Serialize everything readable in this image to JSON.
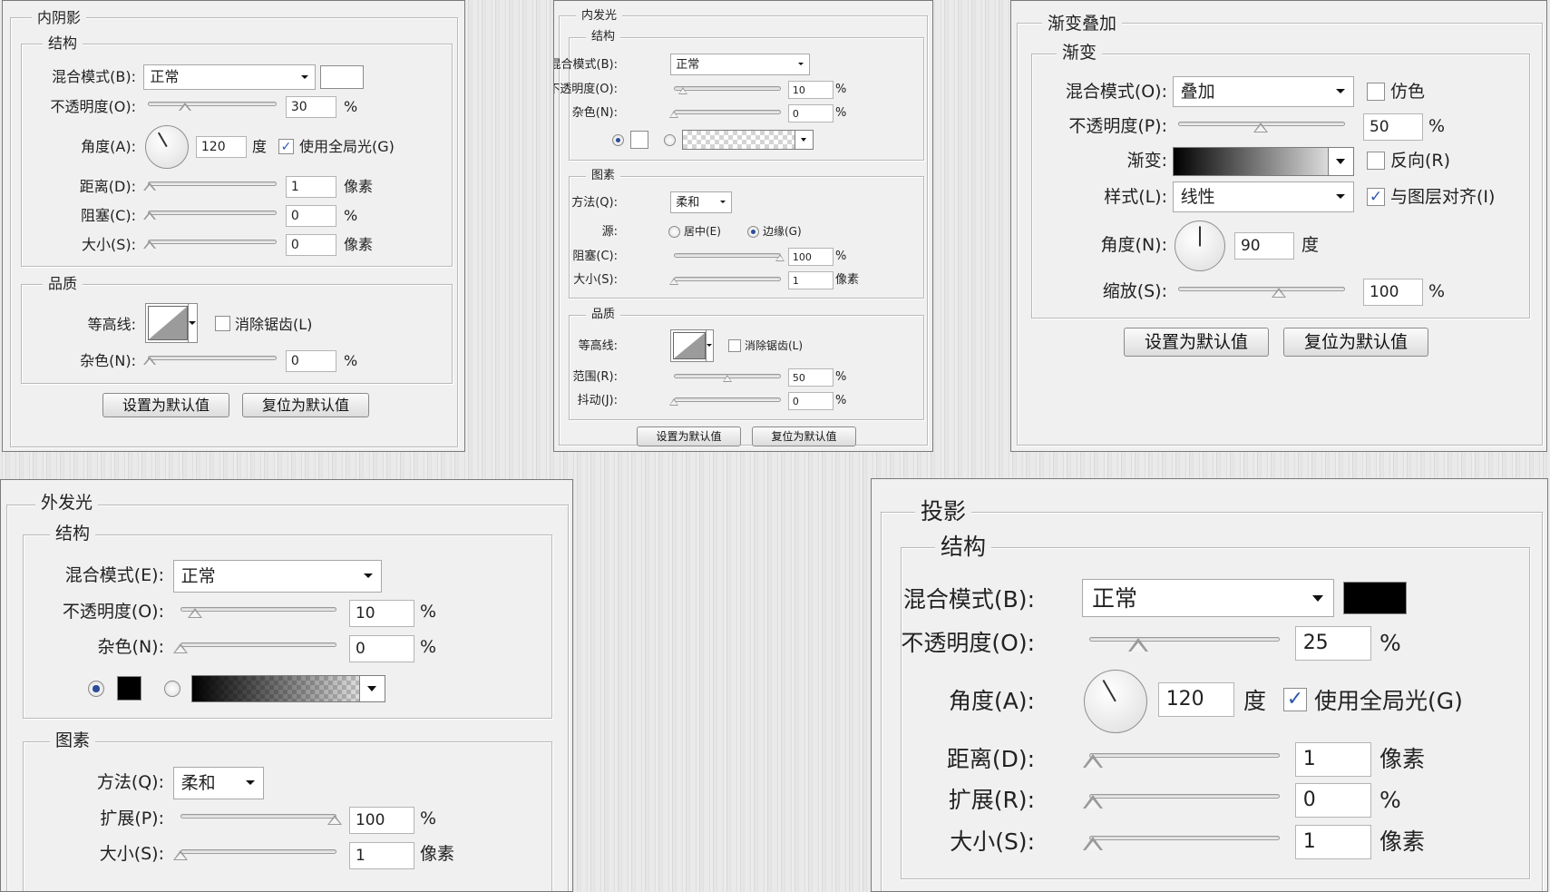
{
  "colors": {
    "panel_bg": "#f0f0f0",
    "check_blue": "#2d57b0",
    "black": "#000000",
    "white": "#ffffff"
  },
  "icons": {
    "checkmark": "✓"
  },
  "inner_shadow": {
    "title": "内阴影",
    "structure_title": "结构",
    "quality_title": "品质",
    "blend_label": "混合模式(B):",
    "blend_value": "正常",
    "color": "#ffffff",
    "opacity_label": "不透明度(O):",
    "opacity_value": "30",
    "opacity_unit": "%",
    "angle_label": "角度(A):",
    "angle_value": "120",
    "angle_unit": "度",
    "global_light_label": "使用全局光(G)",
    "global_light_checked": true,
    "distance_label": "距离(D):",
    "distance_value": "1",
    "distance_unit": "像素",
    "choke_label": "阻塞(C):",
    "choke_value": "0",
    "choke_unit": "%",
    "size_label": "大小(S):",
    "size_value": "0",
    "size_unit": "像素",
    "contour_label": "等高线:",
    "antialias_label": "消除锯齿(L)",
    "noise_label": "杂色(N):",
    "noise_value": "0",
    "noise_unit": "%",
    "default_btn": "设置为默认值",
    "reset_btn": "复位为默认值"
  },
  "inner_glow": {
    "title": "内发光",
    "structure_title": "结构",
    "elements_title": "图素",
    "quality_title": "品质",
    "blend_label": "混合模式(B):",
    "blend_value": "正常",
    "opacity_label": "不透明度(O):",
    "opacity_value": "10",
    "opacity_unit": "%",
    "noise_label": "杂色(N):",
    "noise_value": "0",
    "noise_unit": "%",
    "color": "#ffffff",
    "technique_label": "方法(Q):",
    "technique_value": "柔和",
    "source_label": "源:",
    "source_center": "居中(E)",
    "source_edge": "边缘(G)",
    "choke_label": "阻塞(C):",
    "choke_value": "100",
    "choke_unit": "%",
    "size_label": "大小(S):",
    "size_value": "1",
    "size_unit": "像素",
    "contour_label": "等高线:",
    "antialias_label": "消除锯齿(L)",
    "range_label": "范围(R):",
    "range_value": "50",
    "range_unit": "%",
    "jitter_label": "抖动(J):",
    "jitter_value": "0",
    "jitter_unit": "%",
    "default_btn": "设置为默认值",
    "reset_btn": "复位为默认值"
  },
  "gradient_overlay": {
    "title": "渐变叠加",
    "group_title": "渐变",
    "blend_label": "混合模式(O):",
    "blend_value": "叠加",
    "dither_label": "仿色",
    "opacity_label": "不透明度(P):",
    "opacity_value": "50",
    "opacity_unit": "%",
    "gradient_label": "渐变:",
    "reverse_label": "反向(R)",
    "style_label": "样式(L):",
    "style_value": "线性",
    "align_label": "与图层对齐(I)",
    "align_checked": true,
    "angle_label": "角度(N):",
    "angle_value": "90",
    "angle_unit": "度",
    "scale_label": "缩放(S):",
    "scale_value": "100",
    "scale_unit": "%",
    "default_btn": "设置为默认值",
    "reset_btn": "复位为默认值"
  },
  "outer_glow": {
    "title": "外发光",
    "structure_title": "结构",
    "elements_title": "图素",
    "blend_label": "混合模式(E):",
    "blend_value": "正常",
    "opacity_label": "不透明度(O):",
    "opacity_value": "10",
    "opacity_unit": "%",
    "noise_label": "杂色(N):",
    "noise_value": "0",
    "noise_unit": "%",
    "color": "#000000",
    "technique_label": "方法(Q):",
    "technique_value": "柔和",
    "spread_label": "扩展(P):",
    "spread_value": "100",
    "spread_unit": "%",
    "size_label": "大小(S):",
    "size_value": "1",
    "size_unit": "像素"
  },
  "drop_shadow": {
    "title": "投影",
    "structure_title": "结构",
    "blend_label": "混合模式(B):",
    "blend_value": "正常",
    "color": "#000000",
    "opacity_label": "不透明度(O):",
    "opacity_value": "25",
    "opacity_unit": "%",
    "angle_label": "角度(A):",
    "angle_value": "120",
    "angle_unit": "度",
    "global_light_label": "使用全局光(G)",
    "global_light_checked": true,
    "distance_label": "距离(D):",
    "distance_value": "1",
    "distance_unit": "像素",
    "spread_label": "扩展(R):",
    "spread_value": "0",
    "spread_unit": "%",
    "size_label": "大小(S):",
    "size_value": "1",
    "size_unit": "像素"
  }
}
